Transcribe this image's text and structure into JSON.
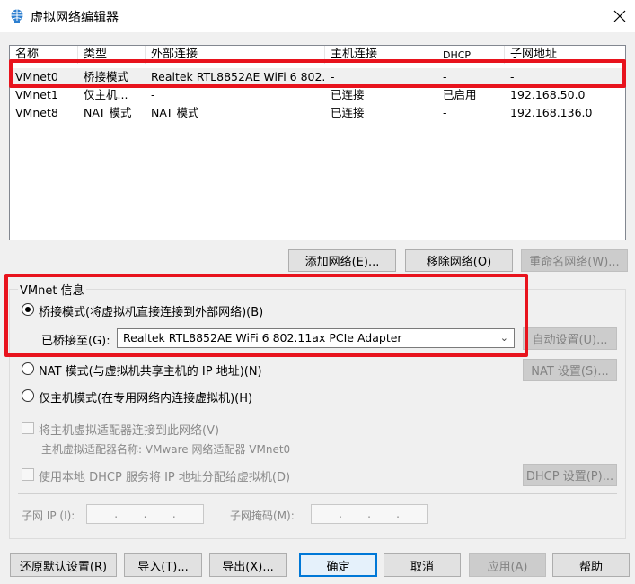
{
  "window": {
    "title": "虚拟网络编辑器",
    "close_icon": "×"
  },
  "list": {
    "columns": [
      "名称",
      "类型",
      "外部连接",
      "主机连接",
      "DHCP",
      "子网地址"
    ],
    "rows": [
      [
        "VMnet0",
        "桥接模式",
        "Realtek RTL8852AE WiFi 6 802....",
        "-",
        "-",
        "-"
      ],
      [
        "VMnet1",
        "仅主机...",
        "-",
        "已连接",
        "已启用",
        "192.168.50.0"
      ],
      [
        "VMnet8",
        "NAT 模式",
        "NAT 模式",
        "已连接",
        "-",
        "192.168.136.0"
      ]
    ]
  },
  "list_buttons": {
    "add": "添加网络(E)...",
    "remove": "移除网络(O)",
    "rename": "重命名网络(W)..."
  },
  "info": {
    "group_label": "VMnet 信息",
    "bridge_radio": "桥接模式(将虚拟机直接连接到外部网络)(B)",
    "bridged_to_label": "已桥接至(G):",
    "bridged_to_value": "Realtek RTL8852AE WiFi 6 802.11ax PCIe Adapter",
    "auto_settings": "自动设置(U)...",
    "nat_radio": "NAT 模式(与虚拟机共享主机的 IP 地址)(N)",
    "nat_settings": "NAT 设置(S)...",
    "hostonly_radio": "仅主机模式(在专用网络内连接虚拟机)(H)",
    "connect_adapter": "将主机虚拟适配器连接到此网络(V)",
    "adapter_name": "主机虚拟适配器名称: VMware 网络适配器 VMnet0",
    "use_dhcp": "使用本地 DHCP 服务将 IP 地址分配给虚拟机(D)",
    "dhcp_settings": "DHCP 设置(P)...",
    "subnet_ip_label": "子网 IP (I):",
    "subnet_mask_label": "子网掩码(M):"
  },
  "bottom_buttons": {
    "restore": "还原默认设置(R)",
    "import": "导入(T)...",
    "export": "导出(X)...",
    "ok": "确定",
    "cancel": "取消",
    "apply": "应用(A)",
    "help": "帮助"
  },
  "colors": {
    "highlight": "#e8131d",
    "accent": "#0078d7"
  }
}
